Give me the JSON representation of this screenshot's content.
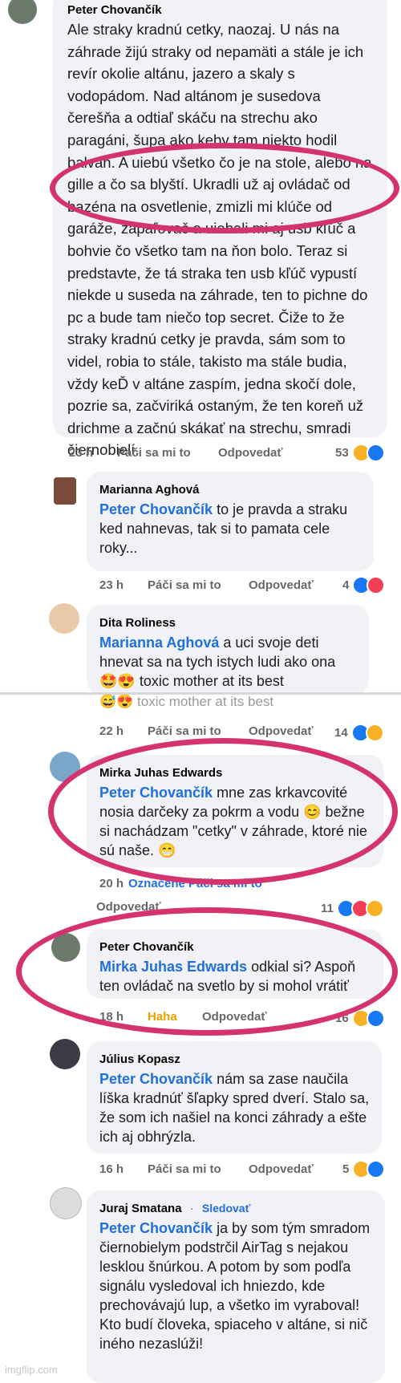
{
  "comments": [
    {
      "author": "Peter Chovančík",
      "text": "Ale straky kradnú cetky, naozaj. U nás na záhrade žijú straky od nepamäti a stále je ich revír okolie altánu, jazero a skaly s vodopádom. Nad altánom je susedova čerešňa a odtiaľ skáču na strechu ako paragáni, šupa ako keby tam niekto hodil balvan. A uiebú všetko čo je na stole, alebo na gille a čo sa blyští. Ukradli už aj ovládač od bazéna na osvetlenie, zmizli mi klúče od garáže, zapaľovač a uiebali mi aj usb kľúč a bohvie čo všetko tam na ňon bolo. Teraz si predstavte, že tá straka ten usb kľúč vypustí niekde u suseda na záhrade, ten to pichne do pc a bude tam niečo top secret. Čiže to že straky kradnú cetky je pravda, sám som to videl, robia to stále, takisto ma stále budia, vždy keĎ v altáne zaspím, jedna skočí dole, pozrie sa, začviriká ostaným, že ten koreň už drichme a začnú skákať na strechu, smradi čiernobielí.",
      "time": "23 h",
      "like": "Páči sa mi to",
      "reply": "Odpovedať",
      "count": "53"
    },
    {
      "author": "Marianna Aghová",
      "mention": "Peter Chovančík",
      "text": " to je pravda a straku ked nahnevas, tak si to pamata cele roky...",
      "time": "23 h",
      "like": "Páči sa mi to",
      "reply": "Odpovedať",
      "count": "4"
    },
    {
      "author": "Dita Roliness",
      "mention": "Marianna Aghová",
      "text": " a uci svoje deti hnevat sa na tych istych ludi ako ona",
      "emoji_line": "🤩😍 toxic mother at its best",
      "dup_line": "😅😍 toxic mother at its best",
      "time": "22 h",
      "like": "Páči sa mi to",
      "reply": "Odpovedať",
      "count": "14"
    },
    {
      "author": "Mirka Juhas Edwards",
      "mention": "Peter Chovančík",
      "text": " mne zas krkavcovité nosia darčeky za pokrm a vodu 😊 bežne si nachádzam \"cetky\" v záhrade, ktoré nie sú naše. 😁",
      "time": "20 h",
      "like": "Označené Páči sa mi to",
      "reply": "Odpovedať",
      "count": "11"
    },
    {
      "author": "Peter Chovančík",
      "mention": "Mirka Juhas Edwards",
      "text": " odkial si? Aspoň ten ovládač na svetlo by si mohol vrátiť",
      "time": "18 h",
      "like": "Haha",
      "reply": "Odpovedať",
      "count": "16"
    },
    {
      "author": "Július Kopasz",
      "mention": "Peter Chovančík",
      "text": " nám sa zase naučila líška kradnúť šľapky spred dverí. Stalo sa, že som ich našiel na konci záhrady a ešte ich aj obhrýzla.",
      "time": "16 h",
      "like": "Páči sa mi to",
      "reply": "Odpovedať",
      "count": "5"
    },
    {
      "author": "Juraj Smatana",
      "separator": "·",
      "follow": "Sledovať",
      "mention": "Peter Chovančík",
      "text": " ja by som tým smradom čiernobielym podstrčil AirTag s nejakou lesklou šnúrkou. A potom by som podľa signálu vysledoval ich hniezdo, kde prechovávajú lup, a všetko im vyraboval! Kto budí človeka, spiaceho v altáne, si nič iného nezaslúži!"
    }
  ],
  "watermark": "imgflip.com",
  "highlight_color": "#d5336f",
  "mention_color": "#216fdb",
  "icons": {
    "like": "like-icon",
    "love": "love-icon",
    "haha": "haha-icon"
  }
}
